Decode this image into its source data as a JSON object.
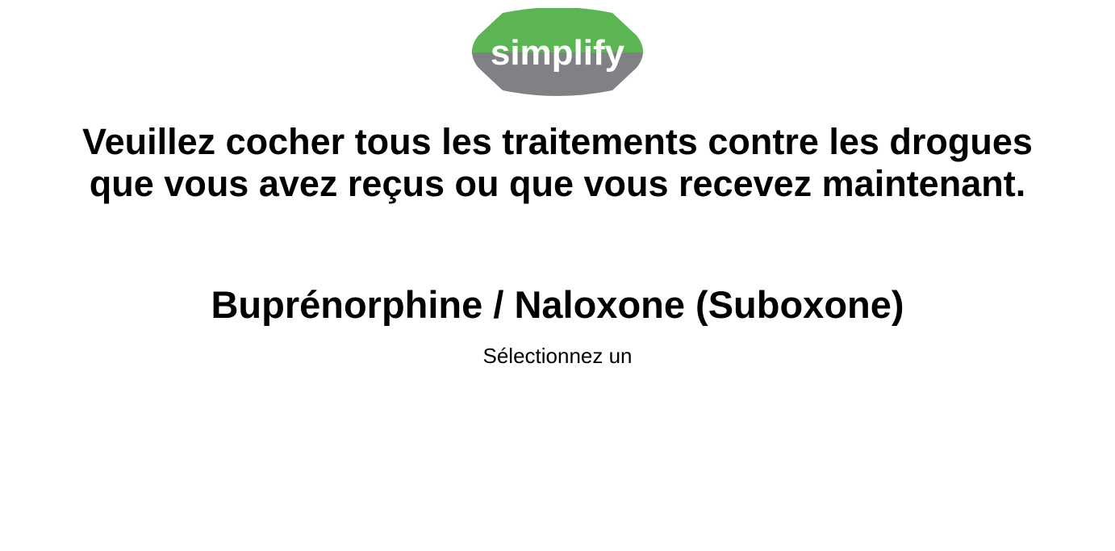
{
  "logo": {
    "text": "simplify",
    "colors": {
      "top": "#5ab552",
      "bottom": "#808184",
      "text": "#ffffff"
    }
  },
  "question": "Veuillez cocher tous les traitements contre les drogues que vous avez reçus ou que vous recevez maintenant.",
  "drug_name": "Buprénorphine / Naloxone (Suboxone)",
  "select_prompt": "Sélectionnez un"
}
